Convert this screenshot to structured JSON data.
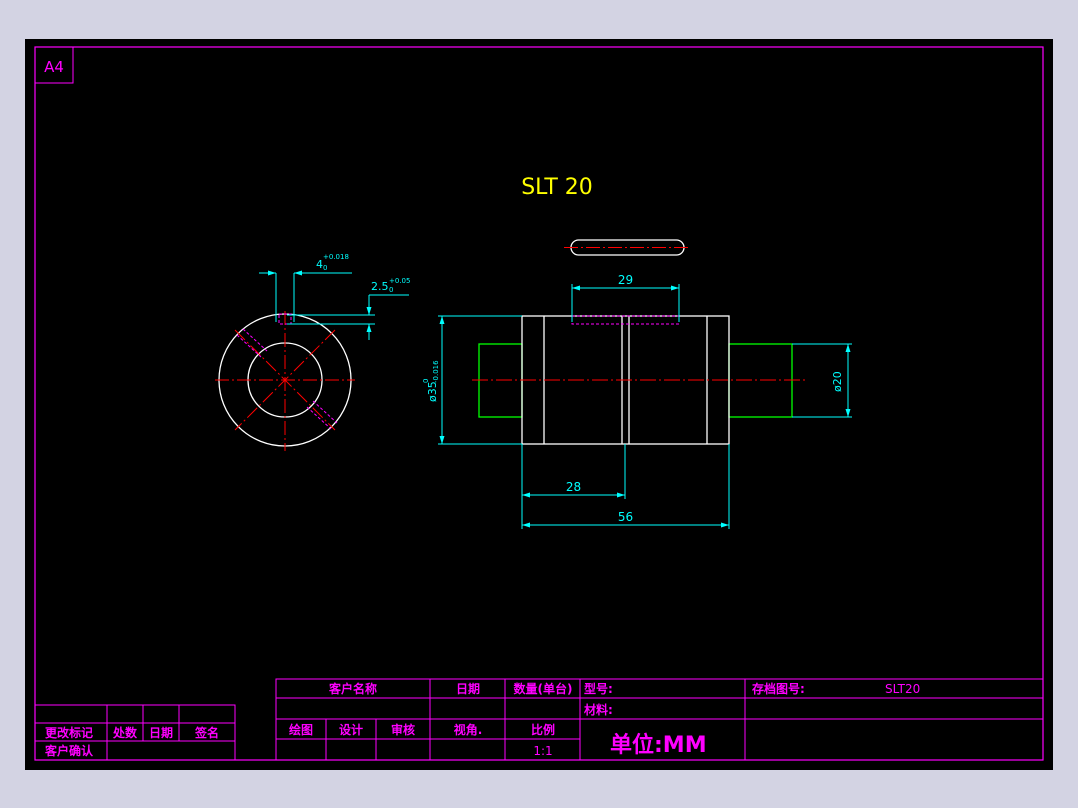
{
  "sheet": {
    "size_label": "A4",
    "title": "SLT 20"
  },
  "dimensions": {
    "slot_width": "4",
    "slot_width_upper_tol": "+0.018",
    "slot_width_lower_tol": "0",
    "slot_depth": "2.5",
    "slot_depth_upper_tol": "+0.05",
    "slot_depth_lower_tol": "0",
    "outer_diameter": "ø35",
    "outer_diameter_upper_tol": "0",
    "outer_diameter_lower_tol": "-0.016",
    "key_length": "29",
    "half_length": "28",
    "total_length": "56",
    "shaft_diameter": "ø20"
  },
  "title_block": {
    "customer_name_label": "客户名称",
    "date_label": "日期",
    "quantity_label": "数量(单台)",
    "model_label": "型号:",
    "archive_no_label": "存档图号:",
    "archive_no_value": "SLT20",
    "material_label": "材料:",
    "draw_label": "绘图",
    "design_label": "设计",
    "review_label": "审核",
    "view_label": "视角.",
    "scale_label": "比例",
    "scale_value": "1:1",
    "unit_label": "单位:MM"
  },
  "revision_block": {
    "change_mark_label": "更改标记",
    "count_label": "处数",
    "date_label": "日期",
    "signature_label": "签名",
    "customer_confirm_label": "客户确认"
  },
  "colors": {
    "border": "#ff00ff",
    "object": "#ffffff",
    "center_line": "#ff0000",
    "dimension": "#00ffff",
    "title_text": "#ffff00",
    "shaft": "#00ff00",
    "hidden": "#ff00ff",
    "block_text": "#ff00ff"
  }
}
